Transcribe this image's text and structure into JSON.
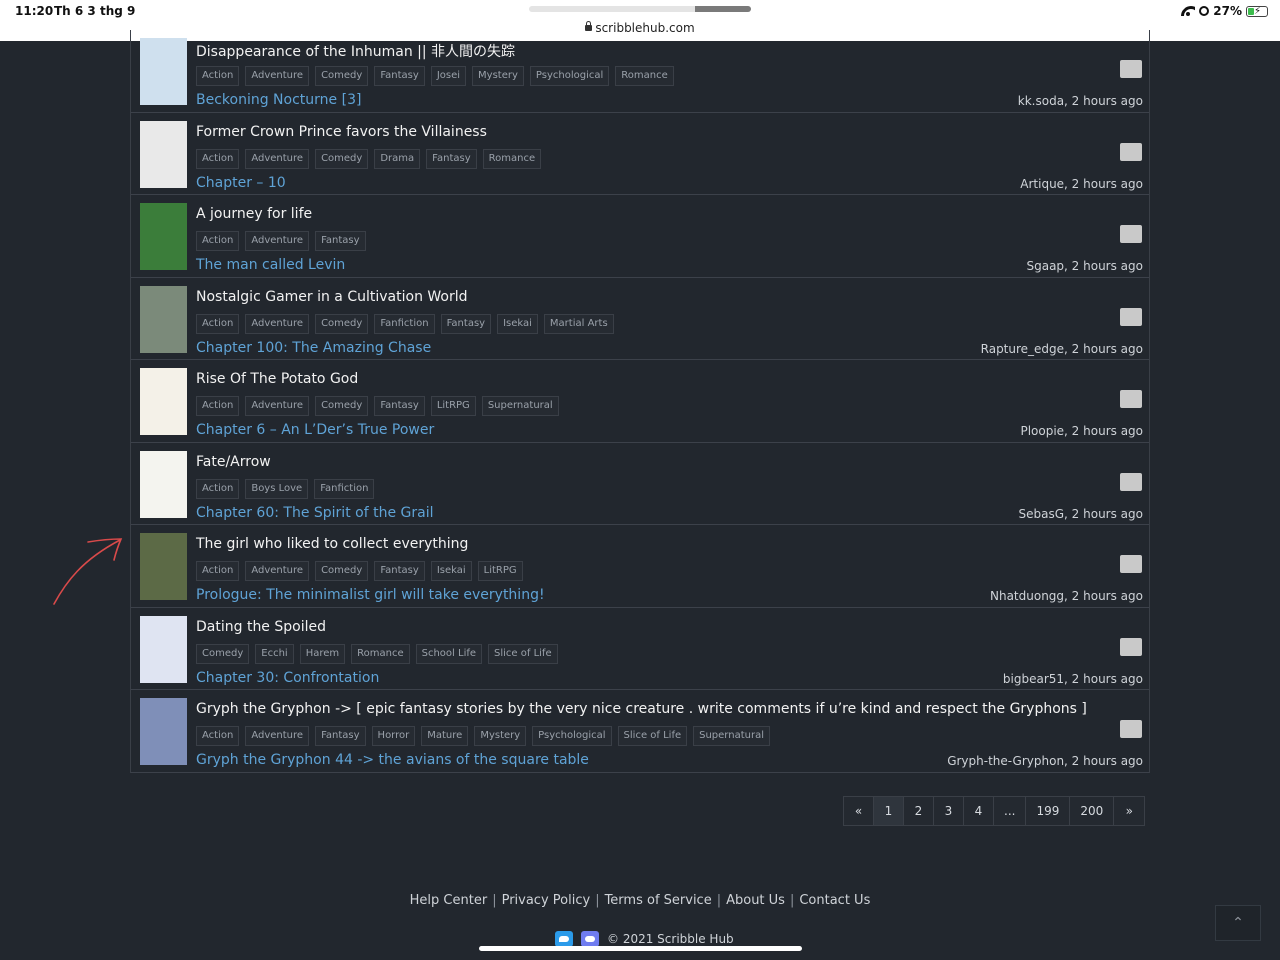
{
  "status": {
    "time": "11:20",
    "date": "Th 6 3 thg 9",
    "battery": "27%"
  },
  "browser": {
    "url": "scribblehub.com"
  },
  "rows": [
    {
      "title": "Disappearance of the Inhuman || 非人間の失踪",
      "tags": [
        "Action",
        "Adventure",
        "Comedy",
        "Fantasy",
        "Josei",
        "Mystery",
        "Psychological",
        "Romance"
      ],
      "chapter": "Beckoning Nocturne [3]",
      "meta": "kk.soda, 2 hours ago",
      "thumb": "#cfe0ee"
    },
    {
      "title": "Former Crown Prince favors the Villainess",
      "tags": [
        "Action",
        "Adventure",
        "Comedy",
        "Drama",
        "Fantasy",
        "Romance"
      ],
      "chapter": "Chapter – 10",
      "meta": "Artique, 2 hours ago",
      "thumb": "#e9e9e9"
    },
    {
      "title": "A journey for life",
      "tags": [
        "Action",
        "Adventure",
        "Fantasy"
      ],
      "chapter": "The man called Levin",
      "meta": "Sgaap, 2 hours ago",
      "thumb": "#3b7d3a"
    },
    {
      "title": "Nostalgic Gamer in a Cultivation World",
      "tags": [
        "Action",
        "Adventure",
        "Comedy",
        "Fanfiction",
        "Fantasy",
        "Isekai",
        "Martial Arts"
      ],
      "chapter": "Chapter 100: The Amazing Chase",
      "meta": "Rapture_edge, 2 hours ago",
      "thumb": "#7b8a7a"
    },
    {
      "title": "Rise Of The Potato God",
      "tags": [
        "Action",
        "Adventure",
        "Comedy",
        "Fantasy",
        "LitRPG",
        "Supernatural"
      ],
      "chapter": "Chapter 6 – An L’Der’s True Power",
      "meta": "Ploopie, 2 hours ago",
      "thumb": "#f4f1e8"
    },
    {
      "title": "Fate/Arrow",
      "tags": [
        "Action",
        "Boys Love",
        "Fanfiction"
      ],
      "chapter": "Chapter 60: The Spirit of the Grail",
      "meta": "SebasG, 2 hours ago",
      "thumb": "#f4f4ef"
    },
    {
      "title": "The girl who liked to collect everything",
      "tags": [
        "Action",
        "Adventure",
        "Comedy",
        "Fantasy",
        "Isekai",
        "LitRPG"
      ],
      "chapter": "Prologue: The minimalist girl will take everything!",
      "meta": "Nhatduongg, 2 hours ago",
      "thumb": "#5c6a46"
    },
    {
      "title": "Dating the Spoiled",
      "tags": [
        "Comedy",
        "Ecchi",
        "Harem",
        "Romance",
        "School Life",
        "Slice of Life"
      ],
      "chapter": "Chapter 30: Confrontation",
      "meta": "bigbear51, 2 hours ago",
      "thumb": "#dfe4f2"
    },
    {
      "title": "Gryph the Gryphon -> [ epic fantasy stories by the very nice creature . write comments if u’re kind and respect the Gryphons ]",
      "tags": [
        "Action",
        "Adventure",
        "Fantasy",
        "Horror",
        "Mature",
        "Mystery",
        "Psychological",
        "Slice of Life",
        "Supernatural"
      ],
      "chapter": "Gryph the Gryphon 44 -> the avians of the square table",
      "meta": "Gryph-the-Gryphon, 2 hours ago",
      "thumb": "#7f8fb8"
    }
  ],
  "pagination": [
    "«",
    "1",
    "2",
    "3",
    "4",
    "...",
    "199",
    "200",
    "»"
  ],
  "pagination_active": "1",
  "footer": {
    "links": [
      "Help Center",
      "Privacy Policy",
      "Terms of Service",
      "About Us",
      "Contact Us"
    ],
    "separator": "|",
    "copyright": "© 2021 Scribble Hub"
  },
  "icons": {
    "twitter": "twitter-icon",
    "discord": "discord-icon",
    "totop": "chevron-up-icon"
  },
  "colors": {
    "background": "#22272e",
    "link": "#5fa3d6",
    "annotation": "#d94a4a"
  }
}
